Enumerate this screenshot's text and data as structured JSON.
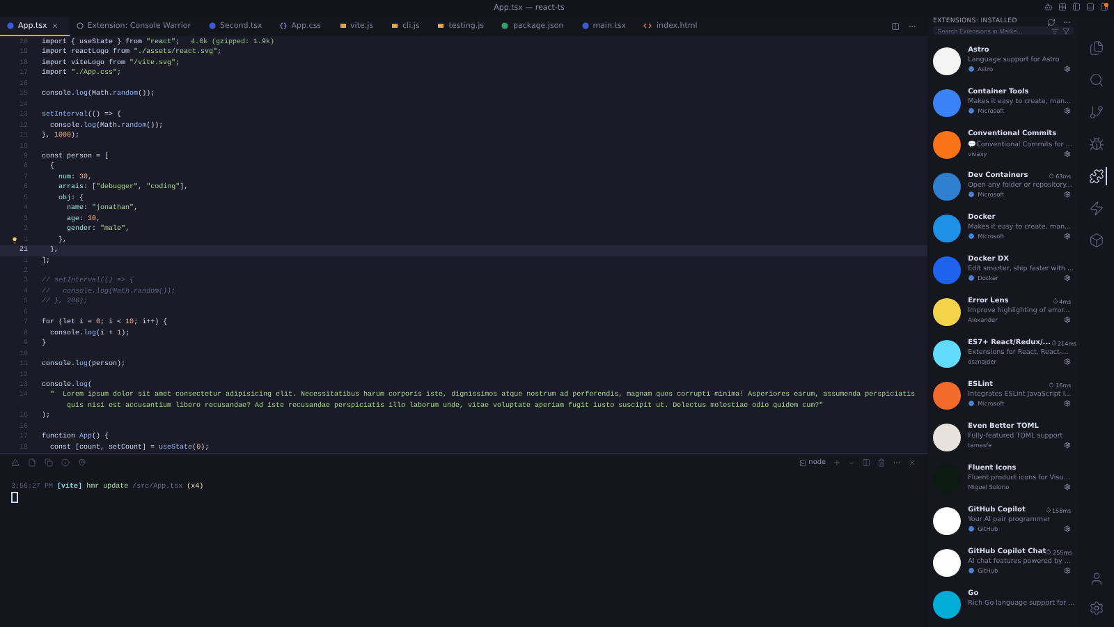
{
  "window": {
    "title": "App.tsx — react-ts"
  },
  "tabs": [
    {
      "label": "App.tsx",
      "kind": "tsx",
      "selected": true
    },
    {
      "label": "Extension: Console Warrior",
      "kind": "extension",
      "selected": false
    },
    {
      "label": "Second.tsx",
      "kind": "tsx",
      "selected": false
    },
    {
      "label": "App.css",
      "kind": "css",
      "selected": false
    },
    {
      "label": "vite.js",
      "kind": "js",
      "selected": false
    },
    {
      "label": "cli.js",
      "kind": "js",
      "selected": false
    },
    {
      "label": "testing.js",
      "kind": "js",
      "selected": false
    },
    {
      "label": "package.json",
      "kind": "json",
      "selected": false
    },
    {
      "label": "main.tsx",
      "kind": "tsx",
      "selected": false
    },
    {
      "label": "index.html",
      "kind": "html",
      "selected": false
    }
  ],
  "editor": {
    "lines": [
      {
        "n": "20",
        "text": "import { useState } from \"react\";",
        "hint": "4.6k (gzipped: 1.9k)",
        "current": false,
        "lightbulb": false
      },
      {
        "n": "19",
        "text": "import reactLogo from \"./assets/react.svg\";",
        "current": false,
        "lightbulb": false
      },
      {
        "n": "18",
        "text": "import viteLogo from \"/vite.svg\";",
        "current": false,
        "lightbulb": false
      },
      {
        "n": "17",
        "text": "import \"./App.css\";",
        "current": false,
        "lightbulb": false
      },
      {
        "n": "16",
        "current": false,
        "lightbulb": false
      },
      {
        "n": "15",
        "text": "console.log(Math.random());",
        "current": false,
        "lightbulb": false
      },
      {
        "n": "14",
        "current": false,
        "lightbulb": false
      },
      {
        "n": "13",
        "text": "setInterval(() => {",
        "current": false,
        "lightbulb": false
      },
      {
        "n": "12",
        "text": "  console.log(Math.random());",
        "current": false,
        "lightbulb": false
      },
      {
        "n": "11",
        "text": "}, 1000);",
        "current": false,
        "lightbulb": false
      },
      {
        "n": "10",
        "current": false,
        "lightbulb": false
      },
      {
        "n": "9",
        "text": "const person = [",
        "current": false,
        "lightbulb": false
      },
      {
        "n": "8",
        "text": "  {",
        "current": false,
        "lightbulb": false
      },
      {
        "n": "7",
        "text": "    num: 30,",
        "current": false,
        "lightbulb": false
      },
      {
        "n": "6",
        "text": "    arrais: [\"debugger\", \"coding\"],",
        "current": false,
        "lightbulb": false
      },
      {
        "n": "5",
        "text": "    obj: {",
        "current": false,
        "lightbulb": false
      },
      {
        "n": "4",
        "text": "      name: \"jonathan\",",
        "current": false,
        "lightbulb": false
      },
      {
        "n": "3",
        "text": "      age: 30,",
        "current": false,
        "lightbulb": false
      },
      {
        "n": "2",
        "text": "      gender: \"male\",",
        "current": false,
        "lightbulb": false
      },
      {
        "n": "1",
        "text": "    },",
        "current": false,
        "lightbulb": true
      },
      {
        "n": "21",
        "text": "  },",
        "current": true,
        "lightbulb": false
      },
      {
        "n": "1",
        "text": "];",
        "current": false,
        "lightbulb": false
      },
      {
        "n": "2",
        "current": false,
        "lightbulb": false
      },
      {
        "n": "3",
        "text": "// setInterval(() => {",
        "current": false,
        "lightbulb": false
      },
      {
        "n": "4",
        "text": "//   console.log(Math.random());",
        "current": false,
        "lightbulb": false
      },
      {
        "n": "5",
        "text": "// }, 200);",
        "current": false,
        "lightbulb": false
      },
      {
        "n": "6",
        "current": false,
        "lightbulb": false
      },
      {
        "n": "7",
        "text": "for (let i = 0; i < 10; i++) {",
        "current": false,
        "lightbulb": false
      },
      {
        "n": "8",
        "text": "  console.log(i + 1);",
        "current": false,
        "lightbulb": false
      },
      {
        "n": "9",
        "text": "}",
        "current": false,
        "lightbulb": false
      },
      {
        "n": "10",
        "current": false,
        "lightbulb": false
      },
      {
        "n": "11",
        "text": "console.log(person);",
        "current": false,
        "lightbulb": false
      },
      {
        "n": "12",
        "current": false,
        "lightbulb": false
      },
      {
        "n": "13",
        "text": "console.log(",
        "current": false,
        "lightbulb": false
      },
      {
        "n": "14",
        "text": "  \"  Lorem ipsum dolor sit amet consectetur adipisicing elit. Necessitatibus harum corporis iste, dignissimos atque nostrum ad perferendis, magnam quos corrupti minima! Asperiores earum, assumenda perspiciatis quis nisi est accusantium libero recusandae? Ad iste recusandae perspiciatis illo laborum unde, vitae voluptate aperiam fugit iusto suscipit ut. Delectus molestiae odio quidem cum?\"",
        "current": false,
        "lightbulb": false
      },
      {
        "n": "15",
        "text": ");",
        "current": false,
        "lightbulb": false
      },
      {
        "n": "16",
        "current": false,
        "lightbulb": false
      },
      {
        "n": "17",
        "text": "function App() {",
        "current": false,
        "lightbulb": false
      },
      {
        "n": "18",
        "text": "  const [count, setCount] = useState(0);",
        "current": false,
        "lightbulb": false
      }
    ]
  },
  "terminal": {
    "shell": "node",
    "output": [
      {
        "time": "3:56:27 PM",
        "source": "[vite]",
        "message": "hmr update",
        "path": "/src/App.tsx",
        "count": "(x4)"
      }
    ]
  },
  "extensions": {
    "title": "EXTENSIONS: INSTALLED",
    "search": {
      "placeholder": "Search Extensions in Marke..."
    },
    "items": [
      {
        "name": "Astro",
        "description": "Language support for Astro",
        "publisher": "Astro",
        "verified": true,
        "color": "#f5f5f5"
      },
      {
        "name": "Container Tools",
        "description": "Makes it easy to create, man...",
        "publisher": "Microsoft",
        "verified": true,
        "color": "#3b82f6"
      },
      {
        "name": "Conventional Commits",
        "description": "💬Conventional Commits for ...",
        "publisher": "vivaxy",
        "verified": false,
        "color": "#f97316"
      },
      {
        "name": "Dev Containers",
        "timing": "63ms",
        "description": "Open any folder or repository...",
        "publisher": "Microsoft",
        "verified": true,
        "color": "#2f80d1"
      },
      {
        "name": "Docker",
        "description": "Makes it easy to create, man...",
        "publisher": "Microsoft",
        "verified": true,
        "color": "#1d91e6"
      },
      {
        "name": "Docker DX",
        "description": "Edit smarter, ship faster with ...",
        "publisher": "Docker",
        "verified": true,
        "color": "#1d63ed"
      },
      {
        "name": "Error Lens",
        "timing": "4ms",
        "description": "Improve highlighting of error...",
        "publisher": "Alexander",
        "verified": false,
        "color": "#f5d34a"
      },
      {
        "name": "ES7+ React/Redux/...",
        "timing": "214ms",
        "description": "Extensions for React, React-...",
        "publisher": "dsznajder",
        "verified": false,
        "color": "#61dafb"
      },
      {
        "name": "ESLint",
        "timing": "16ms",
        "description": "Integrates ESLint JavaScript l...",
        "publisher": "Microsoft",
        "verified": true,
        "color": "#f26b2a"
      },
      {
        "name": "Even Better TOML",
        "description": "Fully-featured TOML support",
        "publisher": "tamasfe",
        "verified": false,
        "color": "#e8e2dc"
      },
      {
        "name": "Fluent Icons",
        "description": "Fluent product icons for Visu...",
        "publisher": "Miguel Solorio",
        "verified": false,
        "color": "#0d1a12"
      },
      {
        "name": "GitHub Copilot",
        "timing": "158ms",
        "description": "Your AI pair programmer",
        "publisher": "GitHub",
        "verified": true,
        "color": "#ffffff"
      },
      {
        "name": "GitHub Copilot Chat",
        "timing": "255ms",
        "description": "AI chat features powered by ...",
        "publisher": "GitHub",
        "verified": true,
        "color": "#fefefe"
      },
      {
        "name": "Go",
        "description": "Rich Go language support for ...",
        "color": "#00add8"
      }
    ]
  },
  "activity_bar": [
    {
      "kind": "files",
      "selected": false
    },
    {
      "kind": "search",
      "selected": false
    },
    {
      "kind": "source-control",
      "selected": false
    },
    {
      "kind": "debug",
      "selected": false
    },
    {
      "kind": "extensions",
      "selected": true
    },
    {
      "kind": "flash",
      "selected": false
    },
    {
      "kind": "box",
      "selected": false
    }
  ]
}
